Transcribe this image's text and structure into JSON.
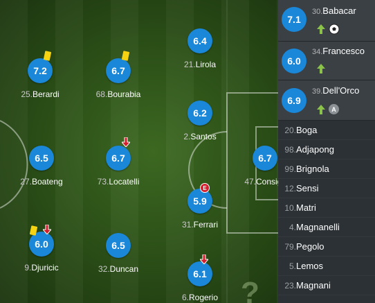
{
  "players": [
    {
      "id": "berardi",
      "rating": "7.2",
      "number": "25.",
      "name": "Berardi"
    },
    {
      "id": "bourabia",
      "rating": "6.7",
      "number": "68.",
      "name": "Bourabia"
    },
    {
      "id": "lirola",
      "rating": "6.4",
      "number": "21.",
      "name": "Lirola"
    },
    {
      "id": "santos",
      "rating": "6.2",
      "number": "2.",
      "name": "Santos"
    },
    {
      "id": "boateng",
      "rating": "6.5",
      "number": "27.",
      "name": "Boateng"
    },
    {
      "id": "locatelli",
      "rating": "6.7",
      "number": "73.",
      "name": "Locatelli"
    },
    {
      "id": "consigli",
      "rating": "6.7",
      "number": "47.",
      "name": "Consigli"
    },
    {
      "id": "ferrari",
      "rating": "5.9",
      "number": "31.",
      "name": "Ferrari"
    },
    {
      "id": "djuricic",
      "rating": "6.0",
      "number": "9.",
      "name": "Djuricic"
    },
    {
      "id": "duncan",
      "rating": "6.5",
      "number": "32.",
      "name": "Duncan"
    },
    {
      "id": "rogerio",
      "rating": "6.1",
      "number": "6.",
      "name": "Rogerio"
    }
  ],
  "own_goal_badge": "E",
  "substitutes_used": [
    {
      "rating": "7.1",
      "number": "30.",
      "name": "Babacar",
      "icons": [
        "sub-in-arrow",
        "ball-icon"
      ]
    },
    {
      "rating": "6.0",
      "number": "34.",
      "name": "Francesco",
      "icons": [
        "sub-in-arrow"
      ]
    },
    {
      "rating": "6.9",
      "number": "39.",
      "name": "Dell'Orco",
      "icons": [
        "sub-in-arrow",
        "assist-icon"
      ],
      "assist_letter": "A"
    }
  ],
  "substitutes_unused": [
    {
      "number": "20.",
      "name": "Boga"
    },
    {
      "number": "98.",
      "name": "Adjapong"
    },
    {
      "number": "99.",
      "name": "Brignola"
    },
    {
      "number": "12.",
      "name": "Sensi"
    },
    {
      "number": "10.",
      "name": "Matri"
    },
    {
      "number": "4.",
      "name": "Magnanelli"
    },
    {
      "number": "79.",
      "name": "Pegolo"
    },
    {
      "number": "5.",
      "name": "Lemos"
    },
    {
      "number": "23.",
      "name": "Magnani"
    }
  ],
  "colors": {
    "rating_bg": "#1a87d8",
    "yellow_card": "#f5d313",
    "sub_out": "#d31e2d",
    "sub_in": "#8bc34a"
  }
}
